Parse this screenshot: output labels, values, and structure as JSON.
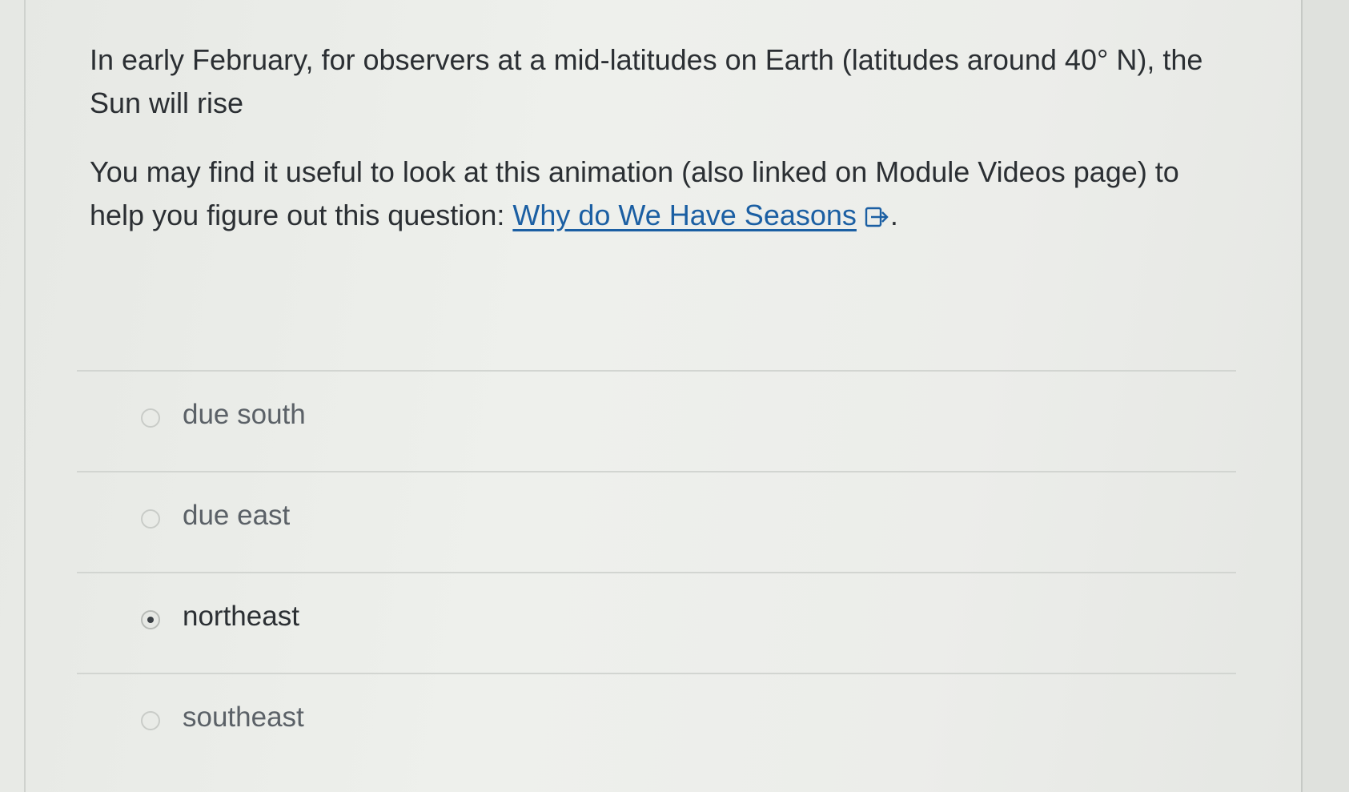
{
  "question": {
    "paragraph1": "In early February, for observers at a mid-latitudes on Earth (latitudes around 40° N), the Sun will rise",
    "paragraph2_prefix": "You may find it useful to look at this animation (also linked on Module Videos page) to help you figure out this question: ",
    "link_text": "Why do We Have Seasons",
    "link_icon": "external-link-icon",
    "paragraph2_suffix": "."
  },
  "answers": [
    {
      "label": "due south",
      "selected": false
    },
    {
      "label": "due east",
      "selected": false
    },
    {
      "label": "northeast",
      "selected": true
    },
    {
      "label": "southeast",
      "selected": false
    }
  ],
  "colors": {
    "link": "#1b5fa3",
    "text": "#2b2f33"
  }
}
